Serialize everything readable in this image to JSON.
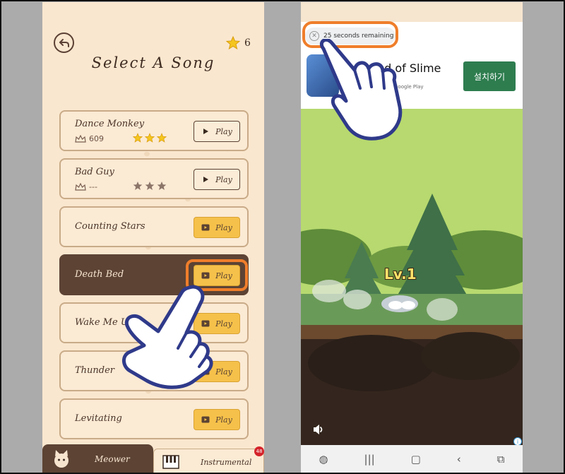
{
  "song_select": {
    "title": "Select A Song",
    "star_total": "6",
    "songs": [
      {
        "name": "Dance Monkey",
        "score": "609",
        "play_label": "Play"
      },
      {
        "name": "Bad Guy",
        "score": "---",
        "play_label": "Play"
      },
      {
        "name": "Counting Stars",
        "play_label": "Play"
      },
      {
        "name": "Death Bed",
        "play_label": "Play"
      },
      {
        "name": "Wake Me Up",
        "play_label": "Play"
      },
      {
        "name": "Thunder",
        "play_label": "Play"
      },
      {
        "name": "Levitating",
        "play_label": "Play"
      }
    ],
    "tabs": {
      "meower": "Meower",
      "instrumental": "Instrumental",
      "instrumental_badge": "48"
    }
  },
  "ad": {
    "timer": "25 seconds remaining",
    "app_title": "nd of Slime",
    "store": "Google Play",
    "install": "설치하기",
    "level": "Lv.1"
  },
  "colors": {
    "accent_highlight": "#ef7e2b",
    "song_bg": "#fbead4",
    "song_active_bg": "#5c4334",
    "play_locked": "#f6c14a",
    "install_green": "#2e7d4f"
  },
  "icons": {
    "back": "back-arrow-icon",
    "star": "star-icon",
    "crown": "crown-icon",
    "play": "play-icon",
    "video": "video-ad-icon",
    "close": "close-icon",
    "hand": "tap-hand-icon",
    "speaker": "speaker-icon"
  }
}
